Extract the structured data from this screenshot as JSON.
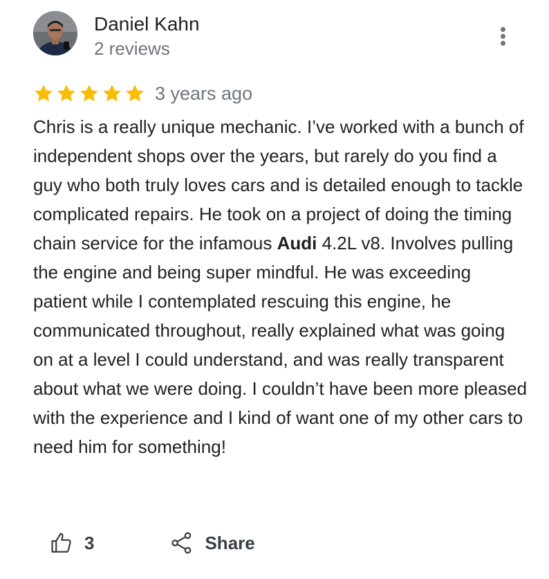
{
  "review": {
    "author_name": "Daniel Kahn",
    "author_meta": "2 reviews",
    "rating": 5,
    "max_rating": 5,
    "date": "3 years ago",
    "text_before_bold": "Chris is a really unique mechanic. I’ve worked with a bunch of independent shops over the years, but rarely do you find a guy who both truly loves cars and is detailed enough to tackle complicated repairs. He took on a project of doing the timing chain service for the infamous ",
    "text_bold": "Audi",
    "text_after_bold": " 4.2L v8. Involves pulling the engine and being super mindful. He was exceeding patient while I contemplated rescuing this engine, he communicated throughout, really explained what was going on at a level I could understand, and was really transparent about what we were doing. I couldn’t have been more pleased with the experience and I kind of want one of my other cars to need him for something!",
    "like_count": "3",
    "share_label": "Share"
  },
  "icons": {
    "more": "more-vert-icon",
    "star": "star-icon",
    "like": "thumb-up-icon",
    "share": "share-icon"
  },
  "colors": {
    "star": "#fbbc04",
    "text": "#202124",
    "secondary_text": "#70757a",
    "action_text": "#3c4043"
  }
}
